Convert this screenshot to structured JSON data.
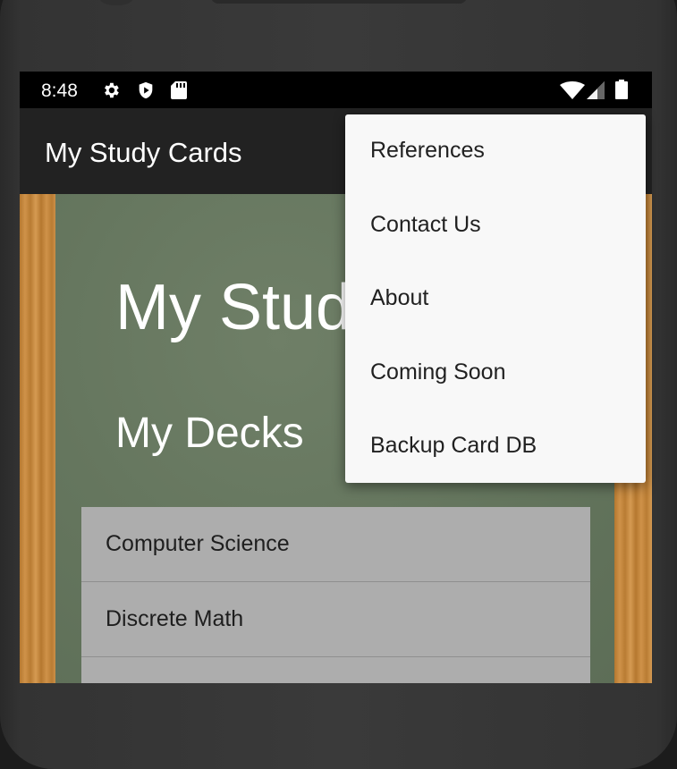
{
  "status_bar": {
    "time": "8:48",
    "icons": [
      "gear-icon",
      "shield-play-icon",
      "sd-card-icon",
      "wifi-icon",
      "signal-icon",
      "battery-icon"
    ]
  },
  "app_bar": {
    "title": "My Study Cards"
  },
  "board": {
    "title": "My Study Cards",
    "decks_heading": "My Decks"
  },
  "decks": [
    {
      "label": "Computer Science"
    },
    {
      "label": "Discrete Math"
    },
    {
      "label": ""
    }
  ],
  "overflow_menu": {
    "items": [
      {
        "label": "References"
      },
      {
        "label": "Contact Us"
      },
      {
        "label": "About"
      },
      {
        "label": "Coming Soon"
      },
      {
        "label": "Backup Card DB"
      }
    ]
  },
  "colors": {
    "app_bar": "#222222",
    "board": "#65765e",
    "wood": "#c48a3e",
    "menu_bg": "#f8f8f8"
  }
}
